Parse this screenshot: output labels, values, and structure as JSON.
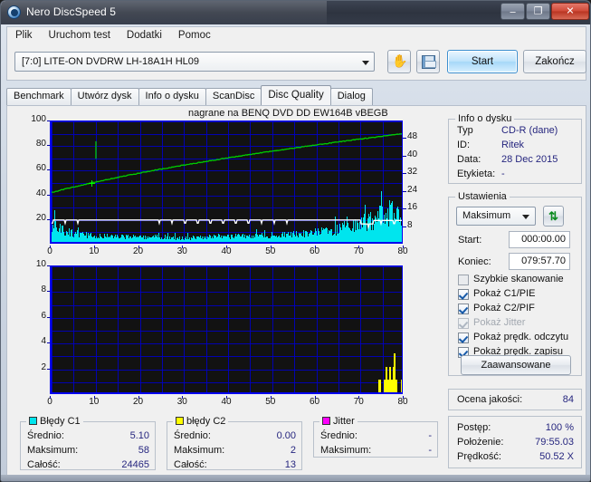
{
  "window": {
    "title": "Nero DiscSpeed 5",
    "app_icon": "disc-icon",
    "minimize": "–",
    "maximize": "❐",
    "close": "✕"
  },
  "menubar": {
    "items": [
      "Plik",
      "Uruchom test",
      "Dodatki",
      "Pomoc"
    ]
  },
  "toolbar": {
    "drive": "[7:0]   LITE-ON DVDRW LH-18A1H HL09",
    "eject_icon": "hand-icon",
    "save_icon": "floppy-disk-icon",
    "start_label": "Start",
    "quit_label": "Zakończ"
  },
  "tabs": [
    {
      "label": "Benchmark",
      "active": false
    },
    {
      "label": "Utwórz dysk",
      "active": false
    },
    {
      "label": "Info o dysku",
      "active": false
    },
    {
      "label": "ScanDisc",
      "active": false
    },
    {
      "label": "Disc Quality",
      "active": true
    },
    {
      "label": "Dialog",
      "active": false
    }
  ],
  "chart_data": {
    "type": "line",
    "title": "nagrane na BENQ    DVD DD EW164B    vBEGB",
    "charts": [
      {
        "id": "c1-errors",
        "type": "area",
        "xlabel": "",
        "ylabel": "",
        "xlim": [
          0,
          80
        ],
        "ylim": [
          0,
          100
        ],
        "y2lim": [
          0,
          56
        ],
        "xticks": [
          0,
          10,
          20,
          30,
          40,
          50,
          60,
          70,
          80
        ],
        "yticks": [
          20,
          40,
          60,
          80,
          100
        ],
        "y2ticks": [
          8,
          16,
          24,
          32,
          40,
          48
        ],
        "grid": true,
        "series": [
          {
            "name": "Błędy C1",
            "color": "#00e5ee",
            "axis": "left"
          },
          {
            "name": "Pokaz prędk. odczytu",
            "color": "#00cc00",
            "axis": "right"
          },
          {
            "name": "Pokaz prędk. zapisu",
            "color": "#ffffff",
            "axis": "right"
          }
        ]
      },
      {
        "id": "c2-errors",
        "type": "bar",
        "xlim": [
          0,
          80
        ],
        "ylim": [
          0,
          10
        ],
        "xticks": [
          0,
          10,
          20,
          30,
          40,
          50,
          60,
          70,
          80
        ],
        "yticks": [
          2,
          4,
          6,
          8,
          10
        ],
        "grid": true,
        "series": [
          {
            "name": "błędy C2",
            "color": "#ffff00",
            "axis": "left"
          }
        ]
      }
    ]
  },
  "disc_info": {
    "legend": "Info o dysku",
    "rows": [
      {
        "label": "Typ",
        "value": "CD-R (dane)"
      },
      {
        "label": "ID:",
        "value": "Ritek"
      },
      {
        "label": "Data:",
        "value": "28 Dec 2015"
      },
      {
        "label": "Etykieta:",
        "value": "-"
      }
    ]
  },
  "settings": {
    "legend": "Ustawienia",
    "speed_selected": "Maksimum",
    "refresh_icon": "refresh-icon",
    "start_label": "Start:",
    "start_value": "000:00.00",
    "end_label": "Koniec:",
    "end_value": "079:57.70",
    "checkboxes": [
      {
        "label": "Szybkie skanowanie",
        "checked": false,
        "disabled": false
      },
      {
        "label": "Pokaż C1/PIE",
        "checked": true,
        "disabled": false
      },
      {
        "label": "Pokaż C2/PIF",
        "checked": true,
        "disabled": false
      },
      {
        "label": "Pokaż Jitter",
        "checked": true,
        "disabled": true
      },
      {
        "label": "Pokaż prędk. odczytu",
        "checked": true,
        "disabled": false
      },
      {
        "label": "Pokaż prędk. zapisu",
        "checked": true,
        "disabled": false
      }
    ],
    "advanced_label": "Zaawansowane"
  },
  "quality": {
    "label": "Ocena jakości:",
    "value": "84"
  },
  "progress": {
    "rows": [
      {
        "label": "Postęp:",
        "value": "100 %"
      },
      {
        "label": "Położenie:",
        "value": "79:55.03"
      },
      {
        "label": "Prędkość:",
        "value": "50.52 X"
      }
    ]
  },
  "stats": {
    "c1": {
      "legend": "Błędy C1",
      "color": "#00e5ee",
      "rows": [
        {
          "label": "Średnio:",
          "value": "5.10"
        },
        {
          "label": "Maksimum:",
          "value": "58"
        },
        {
          "label": "Całość:",
          "value": "24465"
        }
      ]
    },
    "c2": {
      "legend": "błędy C2",
      "color": "#ffff00",
      "rows": [
        {
          "label": "Średnio:",
          "value": "0.00"
        },
        {
          "label": "Maksimum:",
          "value": "2"
        },
        {
          "label": "Całość:",
          "value": "13"
        }
      ]
    },
    "jitter": {
      "legend": "Jitter",
      "color": "#ff00ff",
      "rows": [
        {
          "label": "Średnio:",
          "value": "-"
        },
        {
          "label": "Maksimum:",
          "value": "-"
        }
      ]
    }
  }
}
